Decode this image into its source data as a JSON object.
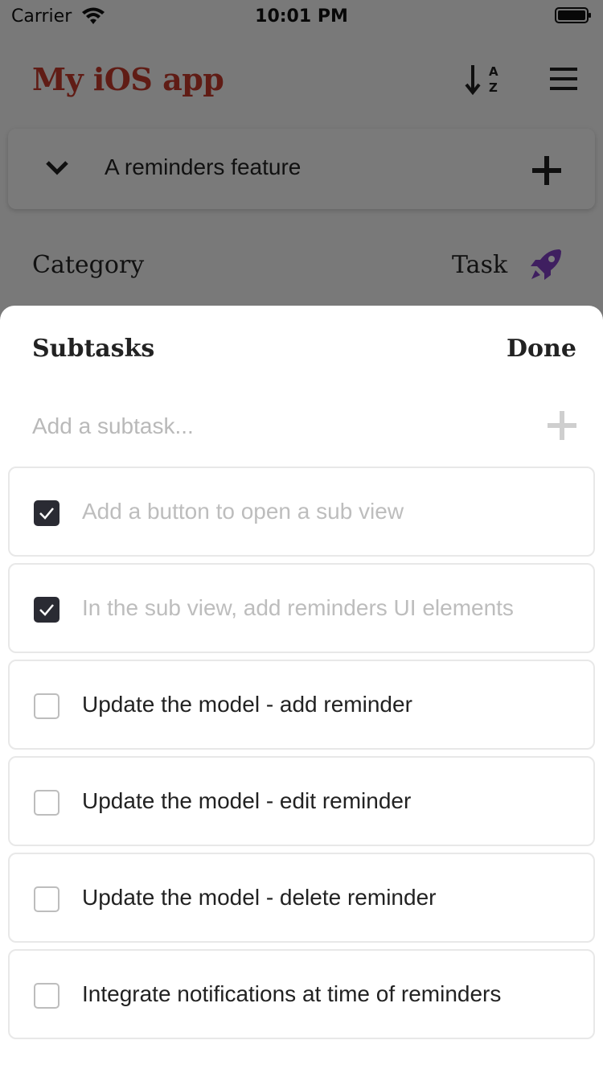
{
  "status_bar": {
    "carrier": "Carrier",
    "time": "10:01 PM"
  },
  "header": {
    "title": "My iOS app",
    "title_color": "#c0392b"
  },
  "feature": {
    "title": "A reminders feature"
  },
  "category": {
    "label": "Category",
    "value": "Task",
    "icon": "rocket-icon",
    "icon_color": "#7e3fc0"
  },
  "sheet": {
    "title": "Subtasks",
    "done_label": "Done",
    "input_placeholder": "Add a subtask...",
    "subtasks": [
      {
        "label": "Add a button to open a sub view",
        "checked": true
      },
      {
        "label": "In the sub view, add reminders UI elements",
        "checked": true
      },
      {
        "label": "Update the model - add reminder",
        "checked": false
      },
      {
        "label": "Update the model - edit reminder",
        "checked": false
      },
      {
        "label": "Update the model - delete reminder",
        "checked": false
      },
      {
        "label": "Integrate notifications at time of reminders",
        "checked": false
      }
    ]
  }
}
